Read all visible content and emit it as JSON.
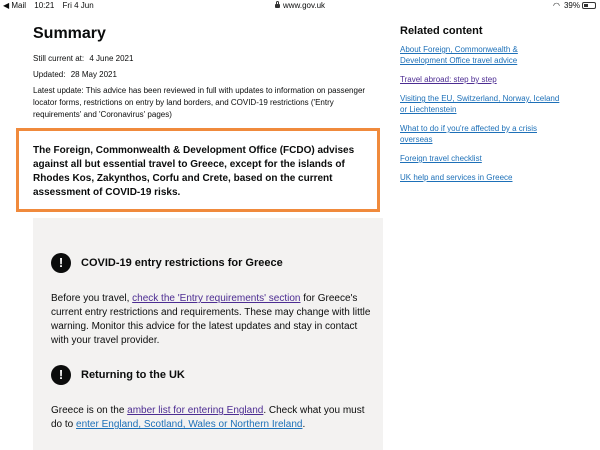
{
  "status_bar": {
    "back_app": "◀ Mail",
    "time": "10:21",
    "date": "Fri 4 Jun",
    "url": "www.gov.uk",
    "battery": "39%"
  },
  "summary": {
    "title": "Summary",
    "still_current_label": "Still current at:",
    "still_current_value": "4 June 2021",
    "updated_label": "Updated:",
    "updated_value": "28 May 2021",
    "latest_update": "Latest update: This advice has been reviewed in full with updates to information on passenger locator forms, restrictions on entry by land borders, and COVID-19 restrictions ('Entry requirements' and 'Coronavirus' pages)",
    "advice": "The Foreign, Commonwealth & Development Office (FCDO) advises against all but essential travel to Greece, except for the islands of Rhodes Kos, Zakynthos, Corfu and Crete, based on the current assessment of COVID-19 risks."
  },
  "panel": {
    "warning1_icon": "!",
    "warning1_title": "COVID-19 entry restrictions for Greece",
    "para1_before": "Before you travel, ",
    "para1_link": "check the 'Entry requirements' section",
    "para1_after": " for Greece's current entry restrictions and requirements. These may change with little warning. Monitor this advice for the latest updates and stay in contact with your travel provider.",
    "warning2_icon": "!",
    "warning2_title": "Returning to the UK",
    "para2_before": "Greece is on the ",
    "para2_link1": "amber list for entering England",
    "para2_mid": ". Check what you must do to ",
    "para2_link2": "enter England, Scotland, Wales or Northern Ireland",
    "para2_after": "."
  },
  "related": {
    "title": "Related content",
    "links": [
      "About Foreign, Commonwealth & Development Office travel advice",
      "Travel abroad: step by step",
      "Visiting the EU, Switzerland, Norway, Iceland or Liechtenstein",
      "What to do if you're affected by a crisis overseas",
      "Foreign travel checklist",
      "UK help and services in Greece"
    ]
  },
  "colors": {
    "link": "#1d70b8",
    "visited_link": "#4c2c92",
    "highlight": "#f08a3c",
    "panel_bg": "#f3f2f1"
  }
}
